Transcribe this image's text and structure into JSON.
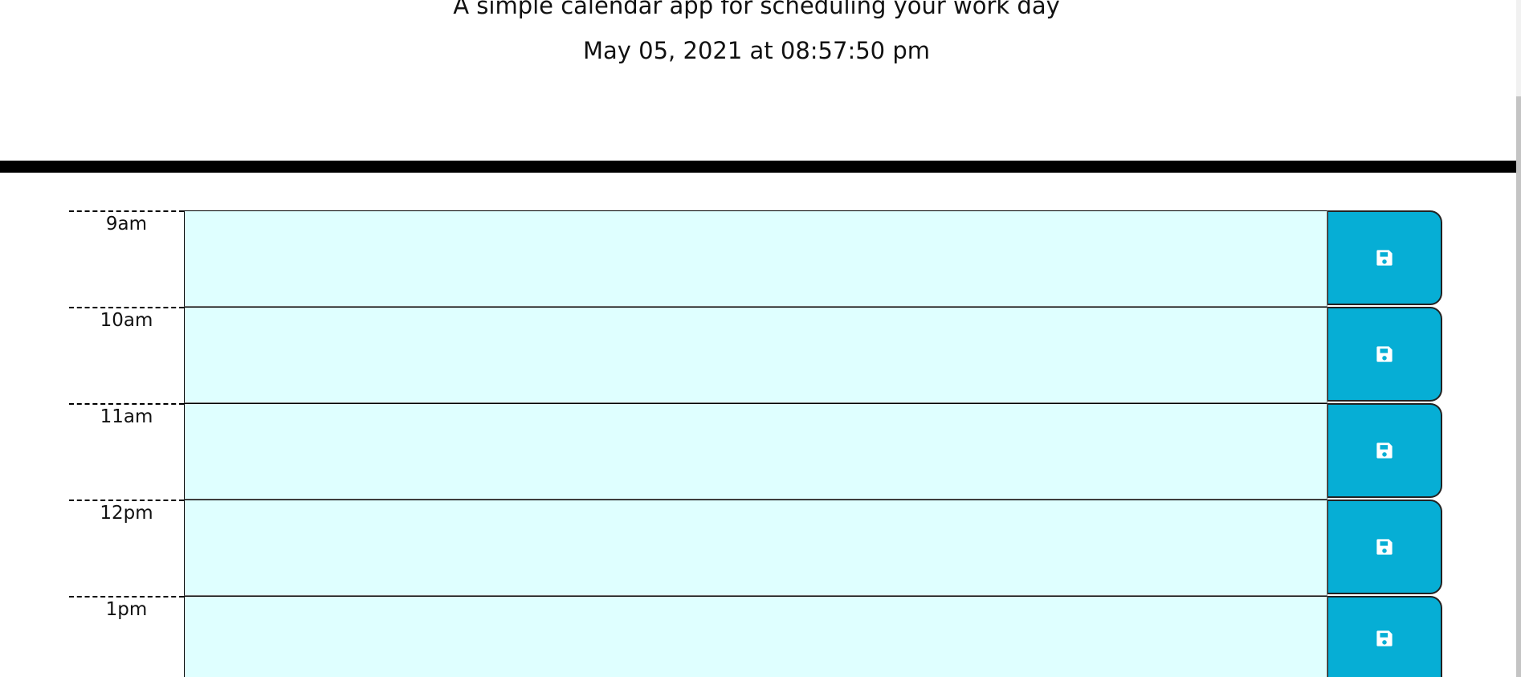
{
  "header": {
    "subtitle": "A simple calendar app for scheduling your work day",
    "current_datetime": "May 05, 2021 at 08:57:50 pm"
  },
  "timeblocks": [
    {
      "hour": "9am",
      "task": "",
      "save_icon": "save-icon"
    },
    {
      "hour": "10am",
      "task": "",
      "save_icon": "save-icon"
    },
    {
      "hour": "11am",
      "task": "",
      "save_icon": "save-icon"
    },
    {
      "hour": "12pm",
      "task": "",
      "save_icon": "save-icon"
    },
    {
      "hour": "1pm",
      "task": "",
      "save_icon": "save-icon"
    }
  ],
  "colors": {
    "task_background": "#dfffff",
    "save_button": "#06aed5",
    "rule": "#000000"
  }
}
